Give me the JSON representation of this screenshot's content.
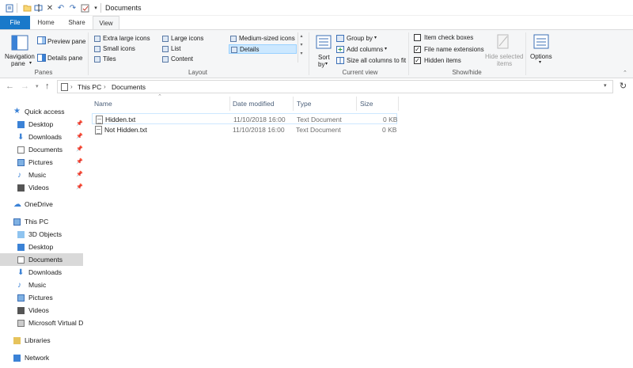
{
  "window": {
    "title": "Documents"
  },
  "quick_access": [
    {
      "icon": "properties-icon"
    },
    {
      "icon": "new-folder-icon"
    },
    {
      "icon": "rename-icon"
    },
    {
      "icon": "delete-icon"
    },
    {
      "icon": "undo-icon"
    },
    {
      "icon": "redo-icon"
    },
    {
      "icon": "checkmark-icon"
    },
    {
      "icon": "customize-dropdown-icon"
    }
  ],
  "tabs": [
    "File",
    "Home",
    "Share",
    "View"
  ],
  "ribbon": {
    "panes": {
      "navigation_pane": "Navigation",
      "navigation_pane2": "pane",
      "preview_pane": "Preview pane",
      "details_pane": "Details pane",
      "label": "Panes"
    },
    "layout": {
      "items": [
        "Extra large icons",
        "Large icons",
        "Medium-sized icons",
        "Small icons",
        "List",
        "Details",
        "Tiles",
        "Content"
      ],
      "selected": "Details",
      "label": "Layout"
    },
    "current_view": {
      "sort_by": "Sort",
      "sort_by2": "by",
      "group_by": "Group by",
      "add_columns": "Add columns",
      "size_columns": "Size all columns to fit",
      "label": "Current view"
    },
    "show_hide": {
      "item_check_boxes": "Item check boxes",
      "file_name_extensions": "File name extensions",
      "hidden_items": "Hidden items",
      "hide_selected": "Hide selected",
      "hide_selected2": "items",
      "label": "Show/hide"
    },
    "options": "Options"
  },
  "address": {
    "crumbs": [
      "This PC",
      "Documents"
    ]
  },
  "nav_pane": {
    "quick_access": "Quick access",
    "quick_items": [
      "Desktop",
      "Downloads",
      "Documents",
      "Pictures",
      "Music",
      "Videos"
    ],
    "onedrive": "OneDrive",
    "this_pc": "This PC",
    "pc_items": [
      "3D Objects",
      "Desktop",
      "Documents",
      "Downloads",
      "Music",
      "Pictures",
      "Videos",
      "Microsoft Virtual Di"
    ],
    "libraries": "Libraries",
    "network": "Network"
  },
  "file_list": {
    "columns": [
      "Name",
      "Date modified",
      "Type",
      "Size"
    ],
    "rows": [
      {
        "name": "Hidden.txt",
        "date": "11/10/2018 16:00",
        "type": "Text Document",
        "size": "0 KB"
      },
      {
        "name": "Not Hidden.txt",
        "date": "11/10/2018 16:00",
        "type": "Text Document",
        "size": "0 KB"
      }
    ]
  }
}
